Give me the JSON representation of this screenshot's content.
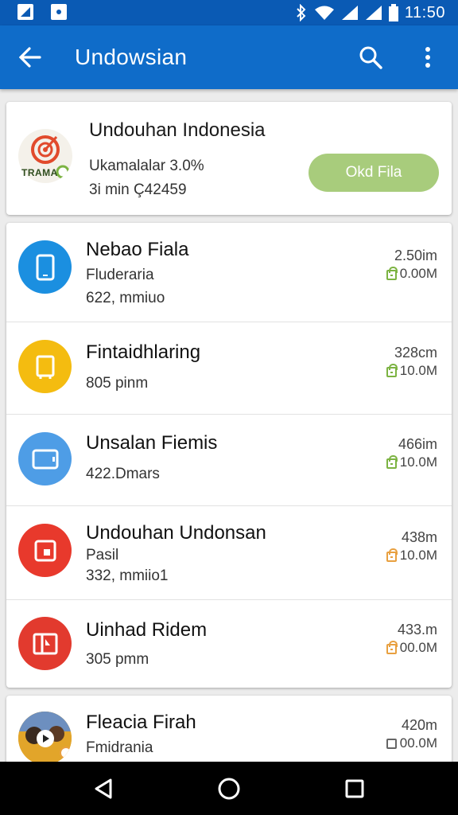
{
  "status_bar": {
    "time": "11:50"
  },
  "app_bar": {
    "title": "Undowsian"
  },
  "featured": {
    "name": "Undouhan Indonesia",
    "rate": "Ukamalalar 3.0%",
    "meta": "3i min Ç42459",
    "logo_text": "TRAMA",
    "action_label": "Okd Fila"
  },
  "items": [
    {
      "title": "Nebao Fiala",
      "subtitle": "Fluderaria",
      "meta": "622, mmiuo",
      "time": "2.50im",
      "size": "0.00M",
      "color": "#1b8fe0",
      "icon": "phone-icon",
      "lock_color": "#7cb342"
    },
    {
      "title": "Fintaidhlaring",
      "subtitle": "",
      "meta": "805 pinm",
      "time": "328cm",
      "size": "10.0M",
      "color": "#f4bc10",
      "icon": "document-icon",
      "lock_color": "#7cb342"
    },
    {
      "title": "Unsalan Fiemis",
      "subtitle": "",
      "meta": "422.Dmars",
      "time": "466im",
      "size": "10.0M",
      "color": "#4e9de6",
      "icon": "tablet-icon",
      "lock_color": "#7cb342"
    },
    {
      "title": "Undouhan Undonsan",
      "subtitle": "Pasil",
      "meta": "332, mmiio1",
      "time": "438m",
      "size": "10.0M",
      "color": "#e8392c",
      "icon": "photo-icon",
      "lock_color": "#e8a040"
    },
    {
      "title": "Uinhad Ridem",
      "subtitle": "",
      "meta": "305 pmm",
      "time": "433.m",
      "size": "00.0M",
      "color": "#e23a2e",
      "icon": "gallery-icon",
      "lock_color": "#e8a040"
    }
  ],
  "bottom_item": {
    "title": "Fleacia Firah",
    "subtitle": "Fmidrania",
    "time": "420m",
    "size": "00.0M"
  }
}
